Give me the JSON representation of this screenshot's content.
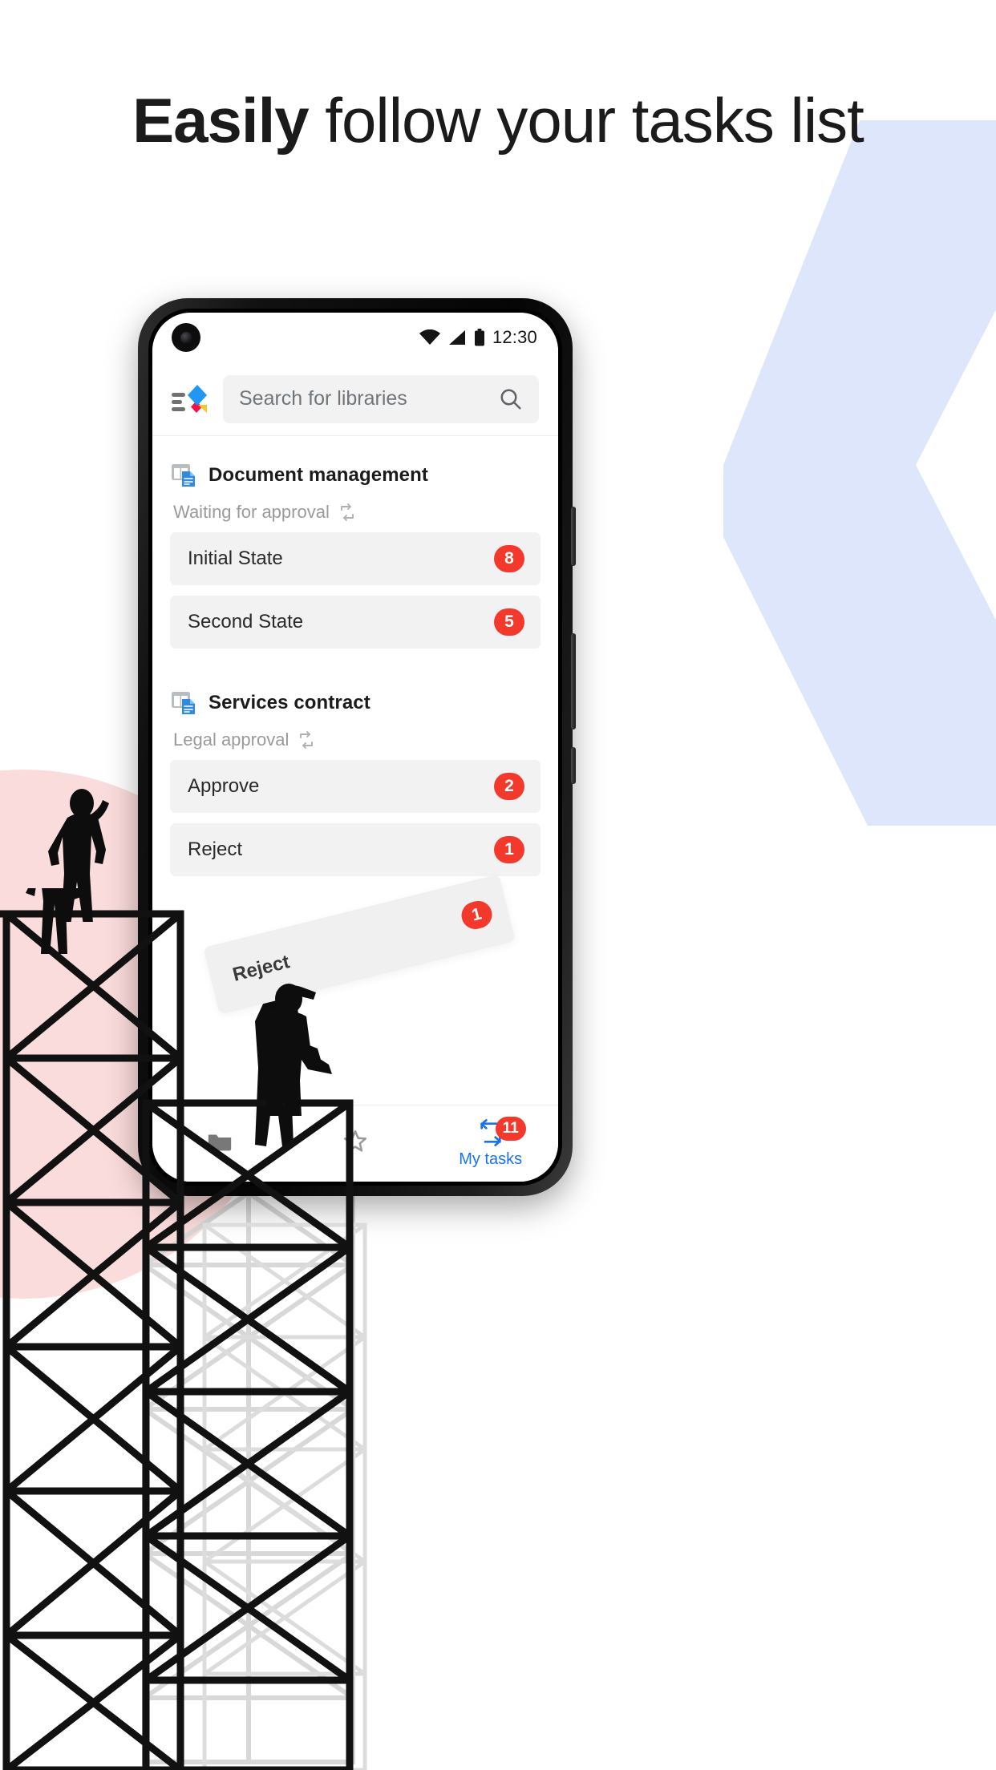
{
  "promo": {
    "headline_bold": "Easily",
    "headline_rest": " follow your tasks list"
  },
  "colors": {
    "badge_red": "#f2392c",
    "accent_blue": "#1a73e8",
    "logo_blue": "#2196f3",
    "logo_red": "#f5104a",
    "logo_yellow": "#fdc52b",
    "chevron_blue": "#dde6fa",
    "pink_blob": "#fbdcdc",
    "row_gray": "#f2f2f2"
  },
  "phone": {
    "statusbar": {
      "time": "12:30",
      "icons": [
        "wifi-icon",
        "signal-icon",
        "battery-icon"
      ],
      "camera": "front-camera"
    },
    "appbar": {
      "logo": "app-logo",
      "menu_icon": "hamburger-menu-icon",
      "search": {
        "placeholder": "Search for libraries",
        "value": "",
        "icon": "search-icon"
      }
    },
    "libraries": [
      {
        "icon": "library-document-icon",
        "name": "Document management",
        "workflow": "Waiting for approval",
        "workflow_icon": "workflow-sync-icon",
        "tasks": [
          {
            "label": "Initial State",
            "count": "8"
          },
          {
            "label": "Second State",
            "count": "5"
          }
        ]
      },
      {
        "icon": "library-document-icon",
        "name": "Services contract",
        "workflow": "Legal approval",
        "workflow_icon": "workflow-sync-icon",
        "tasks": [
          {
            "label": "Approve",
            "count": "2"
          },
          {
            "label": "Reject",
            "count": "1"
          }
        ]
      }
    ],
    "floating_chip": {
      "label": "Reject",
      "count": "1"
    },
    "bottomnav": [
      {
        "id": "files",
        "icon": "folder-icon",
        "label": "",
        "badge": ""
      },
      {
        "id": "favorites",
        "icon": "star-outline-icon",
        "label": "",
        "badge": ""
      },
      {
        "id": "my-tasks",
        "icon": "tasks-icon",
        "label": "My tasks",
        "badge": "11"
      }
    ]
  }
}
